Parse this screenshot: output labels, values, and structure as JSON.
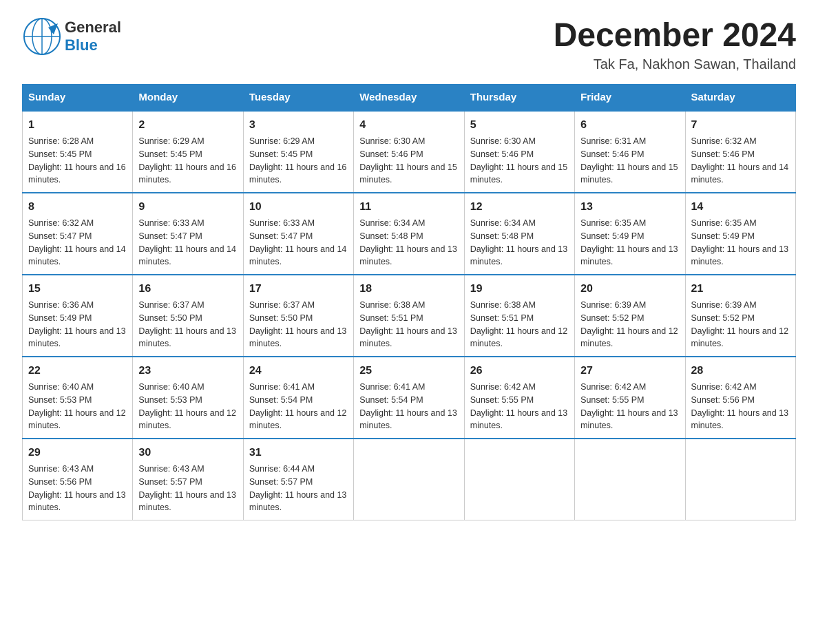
{
  "header": {
    "logo_line1": "General",
    "logo_line2": "Blue",
    "month_title": "December 2024",
    "location": "Tak Fa, Nakhon Sawan, Thailand"
  },
  "days_of_week": [
    "Sunday",
    "Monday",
    "Tuesday",
    "Wednesday",
    "Thursday",
    "Friday",
    "Saturday"
  ],
  "weeks": [
    [
      {
        "day": 1,
        "sunrise": "6:28 AM",
        "sunset": "5:45 PM",
        "daylight": "11 hours and 16 minutes."
      },
      {
        "day": 2,
        "sunrise": "6:29 AM",
        "sunset": "5:45 PM",
        "daylight": "11 hours and 16 minutes."
      },
      {
        "day": 3,
        "sunrise": "6:29 AM",
        "sunset": "5:45 PM",
        "daylight": "11 hours and 16 minutes."
      },
      {
        "day": 4,
        "sunrise": "6:30 AM",
        "sunset": "5:46 PM",
        "daylight": "11 hours and 15 minutes."
      },
      {
        "day": 5,
        "sunrise": "6:30 AM",
        "sunset": "5:46 PM",
        "daylight": "11 hours and 15 minutes."
      },
      {
        "day": 6,
        "sunrise": "6:31 AM",
        "sunset": "5:46 PM",
        "daylight": "11 hours and 15 minutes."
      },
      {
        "day": 7,
        "sunrise": "6:32 AM",
        "sunset": "5:46 PM",
        "daylight": "11 hours and 14 minutes."
      }
    ],
    [
      {
        "day": 8,
        "sunrise": "6:32 AM",
        "sunset": "5:47 PM",
        "daylight": "11 hours and 14 minutes."
      },
      {
        "day": 9,
        "sunrise": "6:33 AM",
        "sunset": "5:47 PM",
        "daylight": "11 hours and 14 minutes."
      },
      {
        "day": 10,
        "sunrise": "6:33 AM",
        "sunset": "5:47 PM",
        "daylight": "11 hours and 14 minutes."
      },
      {
        "day": 11,
        "sunrise": "6:34 AM",
        "sunset": "5:48 PM",
        "daylight": "11 hours and 13 minutes."
      },
      {
        "day": 12,
        "sunrise": "6:34 AM",
        "sunset": "5:48 PM",
        "daylight": "11 hours and 13 minutes."
      },
      {
        "day": 13,
        "sunrise": "6:35 AM",
        "sunset": "5:49 PM",
        "daylight": "11 hours and 13 minutes."
      },
      {
        "day": 14,
        "sunrise": "6:35 AM",
        "sunset": "5:49 PM",
        "daylight": "11 hours and 13 minutes."
      }
    ],
    [
      {
        "day": 15,
        "sunrise": "6:36 AM",
        "sunset": "5:49 PM",
        "daylight": "11 hours and 13 minutes."
      },
      {
        "day": 16,
        "sunrise": "6:37 AM",
        "sunset": "5:50 PM",
        "daylight": "11 hours and 13 minutes."
      },
      {
        "day": 17,
        "sunrise": "6:37 AM",
        "sunset": "5:50 PM",
        "daylight": "11 hours and 13 minutes."
      },
      {
        "day": 18,
        "sunrise": "6:38 AM",
        "sunset": "5:51 PM",
        "daylight": "11 hours and 13 minutes."
      },
      {
        "day": 19,
        "sunrise": "6:38 AM",
        "sunset": "5:51 PM",
        "daylight": "11 hours and 12 minutes."
      },
      {
        "day": 20,
        "sunrise": "6:39 AM",
        "sunset": "5:52 PM",
        "daylight": "11 hours and 12 minutes."
      },
      {
        "day": 21,
        "sunrise": "6:39 AM",
        "sunset": "5:52 PM",
        "daylight": "11 hours and 12 minutes."
      }
    ],
    [
      {
        "day": 22,
        "sunrise": "6:40 AM",
        "sunset": "5:53 PM",
        "daylight": "11 hours and 12 minutes."
      },
      {
        "day": 23,
        "sunrise": "6:40 AM",
        "sunset": "5:53 PM",
        "daylight": "11 hours and 12 minutes."
      },
      {
        "day": 24,
        "sunrise": "6:41 AM",
        "sunset": "5:54 PM",
        "daylight": "11 hours and 12 minutes."
      },
      {
        "day": 25,
        "sunrise": "6:41 AM",
        "sunset": "5:54 PM",
        "daylight": "11 hours and 13 minutes."
      },
      {
        "day": 26,
        "sunrise": "6:42 AM",
        "sunset": "5:55 PM",
        "daylight": "11 hours and 13 minutes."
      },
      {
        "day": 27,
        "sunrise": "6:42 AM",
        "sunset": "5:55 PM",
        "daylight": "11 hours and 13 minutes."
      },
      {
        "day": 28,
        "sunrise": "6:42 AM",
        "sunset": "5:56 PM",
        "daylight": "11 hours and 13 minutes."
      }
    ],
    [
      {
        "day": 29,
        "sunrise": "6:43 AM",
        "sunset": "5:56 PM",
        "daylight": "11 hours and 13 minutes."
      },
      {
        "day": 30,
        "sunrise": "6:43 AM",
        "sunset": "5:57 PM",
        "daylight": "11 hours and 13 minutes."
      },
      {
        "day": 31,
        "sunrise": "6:44 AM",
        "sunset": "5:57 PM",
        "daylight": "11 hours and 13 minutes."
      },
      null,
      null,
      null,
      null
    ]
  ],
  "labels": {
    "sunrise": "Sunrise:",
    "sunset": "Sunset:",
    "daylight": "Daylight:"
  }
}
